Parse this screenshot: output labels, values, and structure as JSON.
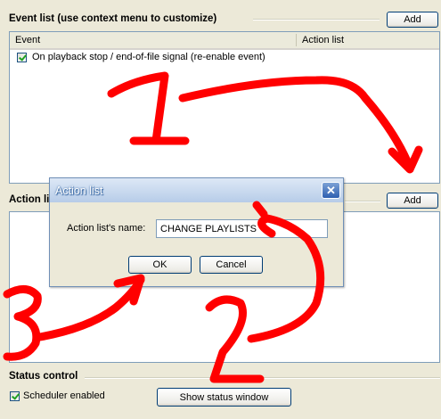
{
  "event_list": {
    "title": "Event list (use context menu to customize)",
    "add_label": "Add",
    "columns": [
      "Event",
      "Action list"
    ],
    "rows": [
      {
        "checked": true,
        "label": "On playback stop / end-of-file signal (re-enable event)"
      }
    ]
  },
  "action_list": {
    "title_partial": "Action li",
    "add_label": "Add"
  },
  "status_control": {
    "title": "Status control",
    "scheduler_label": "Scheduler enabled",
    "scheduler_checked": true,
    "show_status_label": "Show status window"
  },
  "dialog": {
    "title": "Action list",
    "close_glyph": "✕",
    "name_label": "Action list's name:",
    "name_value": "CHANGE PLAYLISTS",
    "ok_label": "OK",
    "cancel_label": "Cancel"
  },
  "annotations": {
    "color": "#ff0000",
    "numbers": [
      "1",
      "2",
      "3"
    ]
  }
}
